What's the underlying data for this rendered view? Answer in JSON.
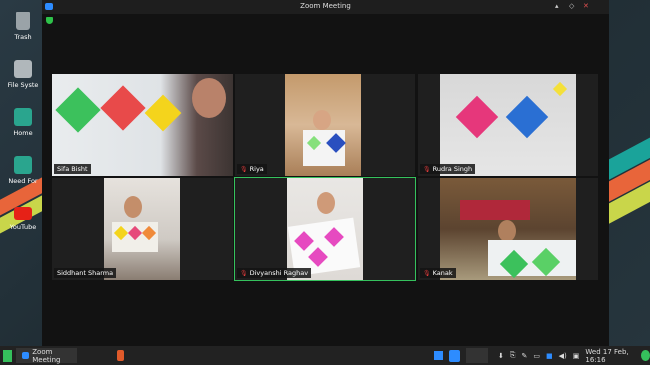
{
  "window": {
    "title": "Zoom Meeting"
  },
  "desktop": {
    "icons": [
      {
        "label": "Trash",
        "icon": "trash-icon",
        "color": "#9aa3a8"
      },
      {
        "label": "File Syste",
        "icon": "drive-icon",
        "color": "#b0b7bb"
      },
      {
        "label": "Home",
        "icon": "home-folder-icon",
        "color": "#2aa58e"
      },
      {
        "label": "Need For",
        "icon": "folder-icon",
        "color": "#2aa58e"
      },
      {
        "label": "YouTube",
        "icon": "youtube-icon",
        "color": "#e62117"
      }
    ]
  },
  "participants": [
    {
      "name": "Sifa Bisht",
      "muted": false
    },
    {
      "name": "Riya",
      "muted": true
    },
    {
      "name": "Rudra Singh",
      "muted": true
    },
    {
      "name": "Siddhant Sharma",
      "muted": false
    },
    {
      "name": "Divyanshi Raghav",
      "muted": true,
      "active": true
    },
    {
      "name": "Kanak",
      "muted": true
    }
  ],
  "taskbar": {
    "menu_icon": "manjaro-menu-icon",
    "app_label": "Zoom Meeting",
    "clock": "Wed 17 Feb, 16:16"
  },
  "colors": {
    "active_border": "#35c25d",
    "zoom_blue": "#2d8cff"
  }
}
